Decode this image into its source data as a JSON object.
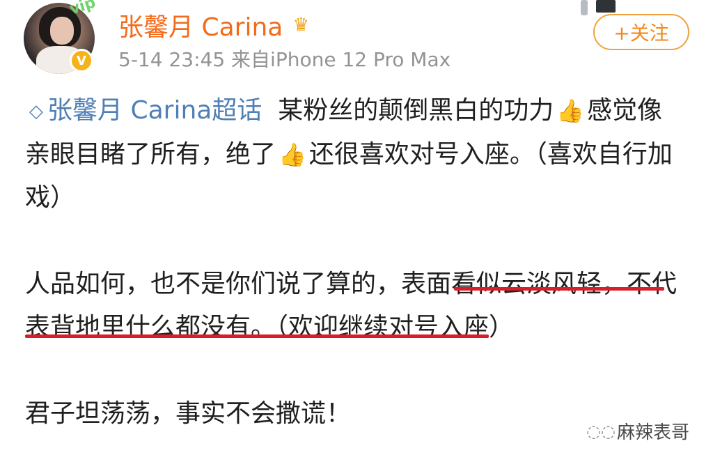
{
  "post": {
    "author": {
      "name": "张馨月 Carina",
      "verified_badge_icon": "verified-v-icon",
      "crown_icon": "crown-icon"
    },
    "meta": "5-14 23:45 来自iPhone 12 Pro Max",
    "follow_label": "+关注",
    "topic": "张馨月 Carina超话",
    "paragraphs": [
      {
        "segments": [
          "某粉丝的颠倒黑白的功力",
          "👍",
          "感觉像亲眼目睹了所有，绝了",
          "👍",
          "还很喜欢对号入座。（喜欢自行加戏）"
        ]
      },
      {
        "text_before": "人品如何，也不是你们说了算的，",
        "underlined": "表面看似云淡风轻，不代表背地里什么都没有。",
        "text_after": "（欢迎继续对号入座）"
      },
      {
        "text": "君子坦荡荡，事实不会撒谎！"
      }
    ]
  },
  "watermark": {
    "icon": "wechat-icon",
    "text": "麻辣表哥"
  },
  "colors": {
    "username": "#f36b1a",
    "topic": "#4f7fb4",
    "underline": "#d81e2a",
    "follow_border": "#f0a23a"
  }
}
